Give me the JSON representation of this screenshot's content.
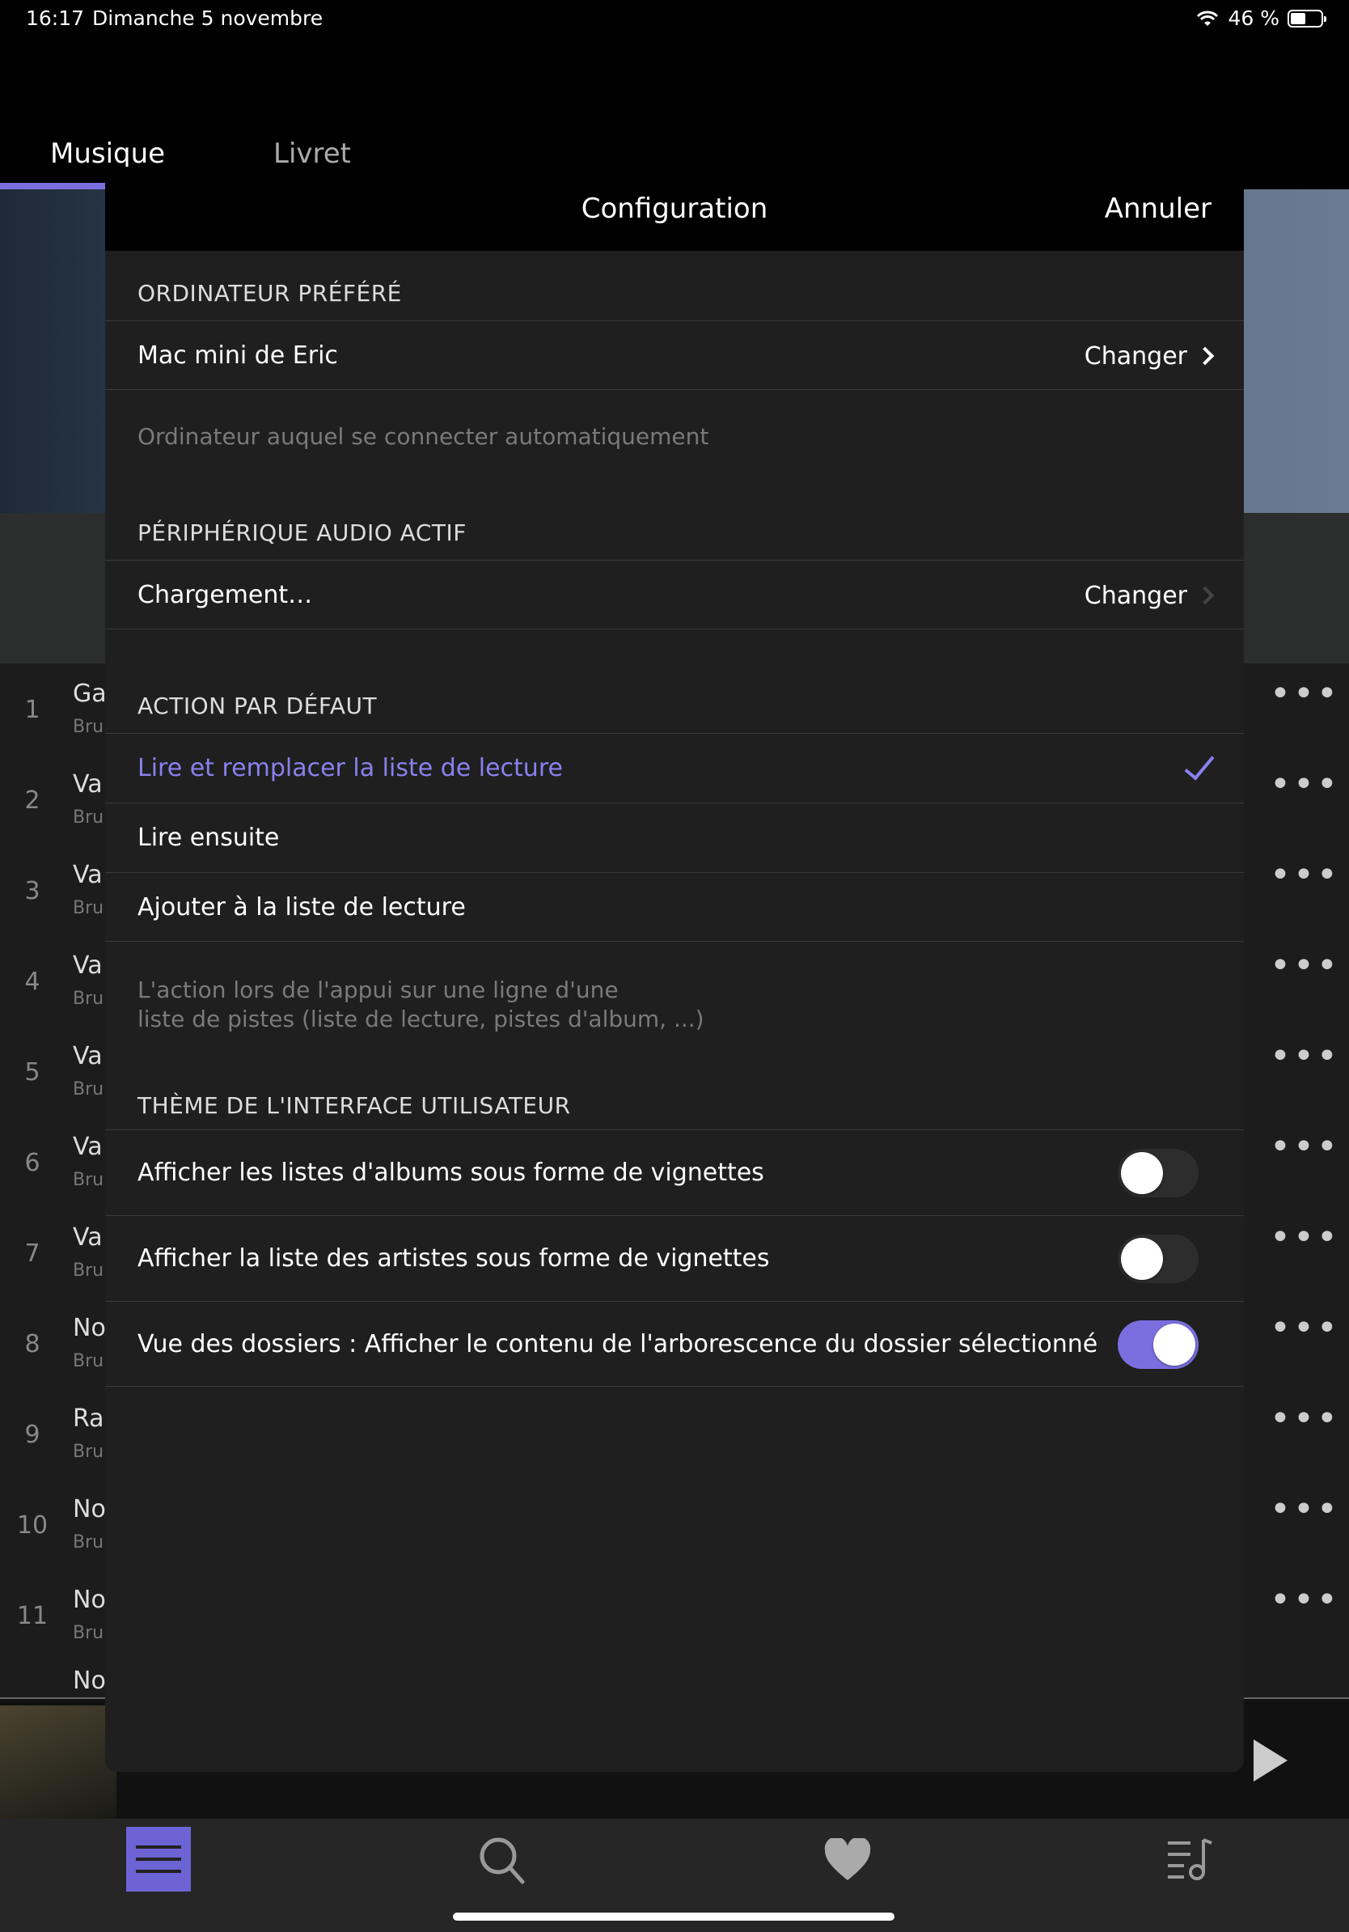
{
  "status_bar": {
    "time": "16:17",
    "date": "Dimanche 5 novembre",
    "battery": "46 %"
  },
  "background": {
    "tabs": [
      "Musique",
      "Livret"
    ],
    "tracks": [
      {
        "num": "1",
        "title": "Ga",
        "sub": "Bru"
      },
      {
        "num": "2",
        "title": "Va",
        "sub": "Bru"
      },
      {
        "num": "3",
        "title": "Va",
        "sub": "Bru"
      },
      {
        "num": "4",
        "title": "Va",
        "sub": "Bru"
      },
      {
        "num": "5",
        "title": "Va",
        "sub": "Bru"
      },
      {
        "num": "6",
        "title": "Va",
        "sub": "Bru"
      },
      {
        "num": "7",
        "title": "Va",
        "sub": "Bru"
      },
      {
        "num": "8",
        "title": "No",
        "sub": "Bru"
      },
      {
        "num": "9",
        "title": "Ra",
        "sub": "Bru"
      },
      {
        "num": "10",
        "title": "No",
        "sub": "Bru"
      },
      {
        "num": "11",
        "title": "No",
        "sub": "Bru"
      },
      {
        "num": "",
        "title": "No",
        "sub": ""
      }
    ],
    "more_label": "•••"
  },
  "modal": {
    "title": "Configuration",
    "cancel": "Annuler",
    "section_computer": {
      "header": "ORDINATEUR PRÉFÉRÉ",
      "value": "Mac mini de Eric",
      "action": "Changer",
      "footer": "Ordinateur auquel se connecter automatiquement"
    },
    "section_audio": {
      "header": "PÉRIPHÉRIQUE AUDIO ACTIF",
      "value": "Chargement…",
      "action": "Changer"
    },
    "section_action": {
      "header": "ACTION PAR DÉFAUT",
      "options": [
        "Lire et remplacer la liste de lecture",
        "Lire ensuite",
        "Ajouter à la liste de lecture"
      ],
      "selected_index": 0,
      "footer_line1": "L'action lors de l'appui sur une ligne d'une",
      "footer_line2": "liste de pistes (liste de lecture, pistes d'album, ...)"
    },
    "section_theme": {
      "header": "THÈME DE L'INTERFACE UTILISATEUR",
      "toggles": [
        {
          "label": "Afficher les listes d'albums sous forme de vignettes",
          "on": false
        },
        {
          "label": "Afficher la liste des artistes sous forme de vignettes",
          "on": false
        },
        {
          "label": "Vue des dossiers : Afficher le contenu de l'arborescence du dossier sélectionné",
          "on": true
        }
      ]
    }
  },
  "icons": [
    "wifi-icon",
    "battery-icon",
    "chevron-right-icon",
    "checkmark-icon",
    "menu-icon",
    "search-icon",
    "heart-icon",
    "playlist-icon",
    "play-icon",
    "more-icon"
  ],
  "colors": {
    "accent": "#7b6fe0",
    "modal_bg": "#1f1f1f",
    "header_bg": "#000000"
  }
}
